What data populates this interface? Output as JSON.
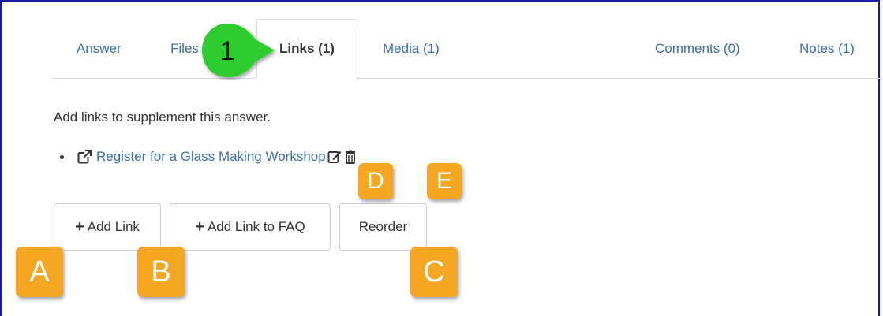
{
  "tabs": [
    {
      "label": "Answer"
    },
    {
      "label": "Files"
    },
    {
      "label": "Links (1)"
    },
    {
      "label": "Media (1)"
    },
    {
      "label": "Comments (0)"
    },
    {
      "label": "Notes (1)"
    }
  ],
  "active_tab": "Links (1)",
  "intro_text": "Add links to supplement this answer.",
  "links": [
    {
      "text": "Register for a Glass Making Workshop"
    }
  ],
  "buttons": {
    "add_link": "Add Link",
    "add_link_faq": "Add Link to FAQ",
    "reorder": "Reorder"
  },
  "callout": {
    "number": "1",
    "color": "#2ecc2e"
  },
  "badges": {
    "a": "A",
    "b": "B",
    "c": "C",
    "d": "D",
    "e": "E",
    "color": "#f5a623"
  },
  "colors": {
    "link": "#3c6ea8",
    "frame": "#1a1aaa"
  }
}
